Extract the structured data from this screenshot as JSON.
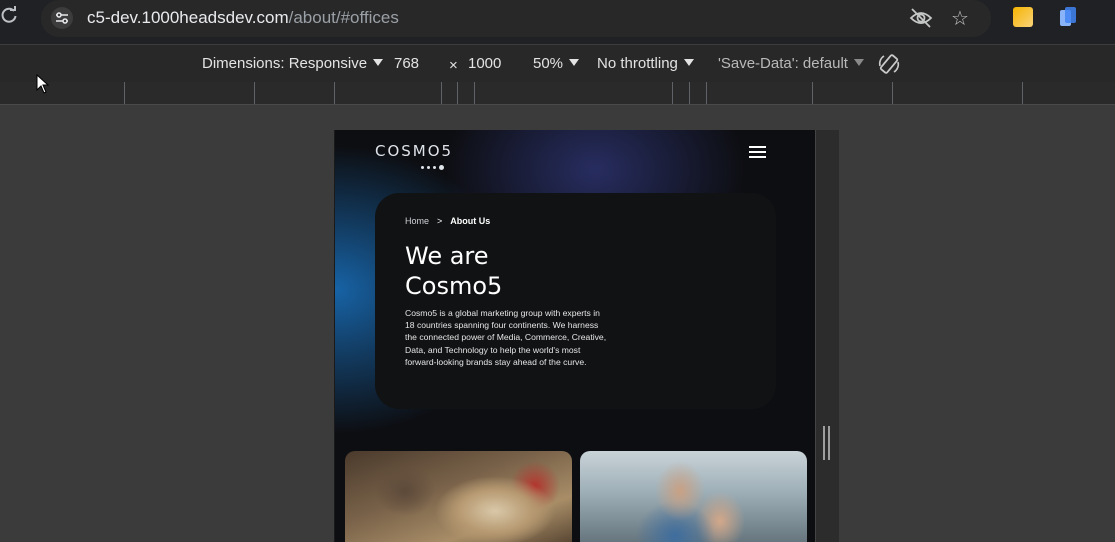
{
  "browser": {
    "url_host": "c5-dev.1000headsdev.com",
    "url_path": "/about/#offices",
    "icons": [
      "reload-icon",
      "tune-icon",
      "eye-off-icon",
      "star-icon",
      "extension-icon",
      "extension-icon"
    ]
  },
  "devtools": {
    "dimensions_label": "Dimensions: Responsive",
    "width": "768",
    "times": "×",
    "height": "1000",
    "zoom": "50%",
    "throttling": "No throttling",
    "save_data": "'Save-Data': default"
  },
  "site": {
    "logo": "COSMO5",
    "breadcrumb": {
      "home": "Home",
      "separator": ">",
      "current": "About Us"
    },
    "heading_line1": "We are",
    "heading_line2": "Cosmo5",
    "blurb": "Cosmo5 is a global marketing group with experts in 18 countries spanning four continents. We harness the connected power of Media, Commerce, Creative, Data, and Technology to help the world's most forward-looking brands stay ahead of the curve."
  }
}
